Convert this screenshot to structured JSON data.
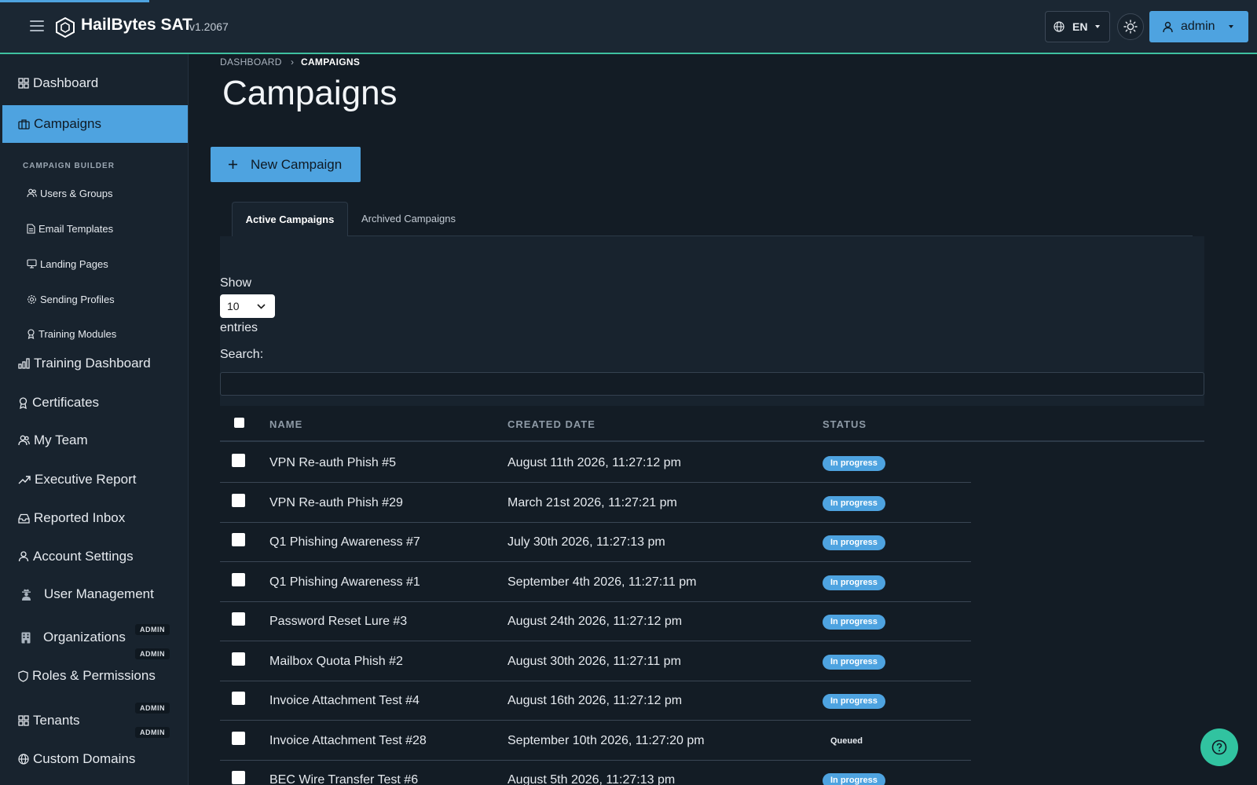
{
  "header": {
    "brand": "HailBytes SAT",
    "version": "v1.2067",
    "language": "EN",
    "user": "admin"
  },
  "sidebar": {
    "items": [
      {
        "label": "Dashboard",
        "icon": "dashboard-icon"
      },
      {
        "label": "Campaigns",
        "icon": "briefcase-icon",
        "active": true
      }
    ],
    "builder_label": "CAMPAIGN BUILDER",
    "builder_items": [
      {
        "label": "Users & Groups",
        "icon": "users-icon"
      },
      {
        "label": "Email Templates",
        "icon": "file-icon"
      },
      {
        "label": "Landing Pages",
        "icon": "monitor-icon"
      },
      {
        "label": "Sending Profiles",
        "icon": "gear-icon"
      },
      {
        "label": "Training Modules",
        "icon": "award-icon"
      }
    ],
    "more_items": [
      {
        "label": "Training Dashboard",
        "icon": "bar-chart-icon"
      },
      {
        "label": "Certificates",
        "icon": "award-icon"
      },
      {
        "label": "My Team",
        "icon": "users-icon"
      },
      {
        "label": "Executive Report",
        "icon": "trending-up-icon"
      },
      {
        "label": "Reported Inbox",
        "icon": "inbox-icon"
      },
      {
        "label": "Account Settings",
        "icon": "user-icon"
      },
      {
        "label": "User Management",
        "icon": "user-secret-icon",
        "badge": "ADMIN"
      },
      {
        "label": "Organizations",
        "icon": "building-icon",
        "badge": "ADMIN"
      },
      {
        "label": "Roles & Permissions",
        "icon": "shield-icon",
        "badge": "ADMIN"
      },
      {
        "label": "Tenants",
        "icon": "grid-icon",
        "badge": "ADMIN"
      },
      {
        "label": "Custom Domains",
        "icon": "globe-icon"
      }
    ]
  },
  "breadcrumb": {
    "home": "DASHBOARD",
    "current": "CAMPAIGNS"
  },
  "page": {
    "title": "Campaigns",
    "new_button": "New Campaign",
    "tabs": [
      "Active Campaigns",
      "Archived Campaigns"
    ]
  },
  "table_controls": {
    "show_label": "Show",
    "entries_value": "10",
    "entries_label": "entries",
    "search_label": "Search:",
    "search_value": ""
  },
  "table": {
    "columns": [
      "NAME",
      "CREATED DATE",
      "STATUS"
    ],
    "rows": [
      {
        "name": "VPN Re-auth Phish #5",
        "date": "August 11th 2026, 11:27:12 pm",
        "status": "In progress"
      },
      {
        "name": "VPN Re-auth Phish #29",
        "date": "March 21st 2026, 11:27:21 pm",
        "status": "In progress"
      },
      {
        "name": "Q1 Phishing Awareness #7",
        "date": "July 30th 2026, 11:27:13 pm",
        "status": "In progress"
      },
      {
        "name": "Q1 Phishing Awareness #1",
        "date": "September 4th 2026, 11:27:11 pm",
        "status": "In progress"
      },
      {
        "name": "Password Reset Lure #3",
        "date": "August 24th 2026, 11:27:12 pm",
        "status": "In progress"
      },
      {
        "name": "Mailbox Quota Phish #2",
        "date": "August 30th 2026, 11:27:11 pm",
        "status": "In progress"
      },
      {
        "name": "Invoice Attachment Test #4",
        "date": "August 16th 2026, 11:27:12 pm",
        "status": "In progress"
      },
      {
        "name": "Invoice Attachment Test #28",
        "date": "September 10th 2026, 11:27:20 pm",
        "status": "Queued"
      },
      {
        "name": "BEC Wire Transfer Test #6",
        "date": "August 5th 2026, 11:27:13 pm",
        "status": "In progress"
      }
    ]
  },
  "colors": {
    "accent": "#4ea3e0",
    "help": "#31c3a0",
    "topbar_border": "#3fc1a0"
  }
}
